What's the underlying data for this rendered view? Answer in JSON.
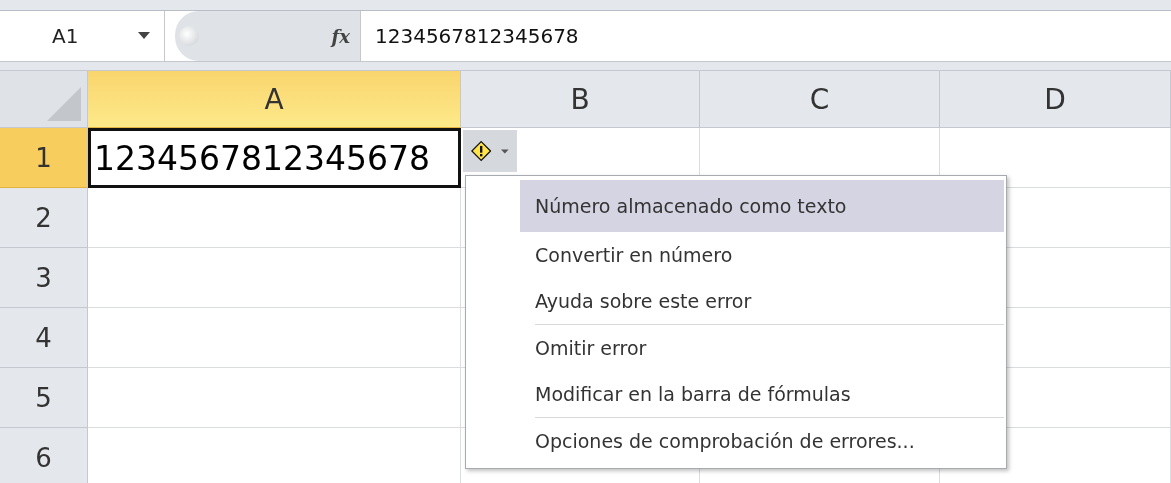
{
  "formula_bar": {
    "name_box": "A1",
    "function_label": "fx",
    "formula": "1234567812345678"
  },
  "columns": [
    {
      "label": "A",
      "selected": true
    },
    {
      "label": "B",
      "selected": false
    },
    {
      "label": "C",
      "selected": false
    },
    {
      "label": "D",
      "selected": false
    }
  ],
  "rows": [
    {
      "label": "1",
      "selected": true,
      "cells": [
        "1234567812345678"
      ]
    },
    {
      "label": "2",
      "selected": false
    },
    {
      "label": "3",
      "selected": false
    },
    {
      "label": "4",
      "selected": false
    },
    {
      "label": "5",
      "selected": false
    },
    {
      "label": "6",
      "selected": false
    }
  ],
  "error_menu": {
    "items": [
      {
        "kind": "header",
        "label": "Número almacenado como texto"
      },
      {
        "kind": "item",
        "label": "Convertir en número"
      },
      {
        "kind": "item",
        "label": "Ayuda sobre este error"
      },
      {
        "kind": "separator"
      },
      {
        "kind": "item",
        "label": "Omitir error"
      },
      {
        "kind": "item",
        "label": "Modificar en la barra de fórmulas"
      },
      {
        "kind": "separator"
      },
      {
        "kind": "item",
        "label": "Opciones de comprobación de errores..."
      }
    ]
  }
}
